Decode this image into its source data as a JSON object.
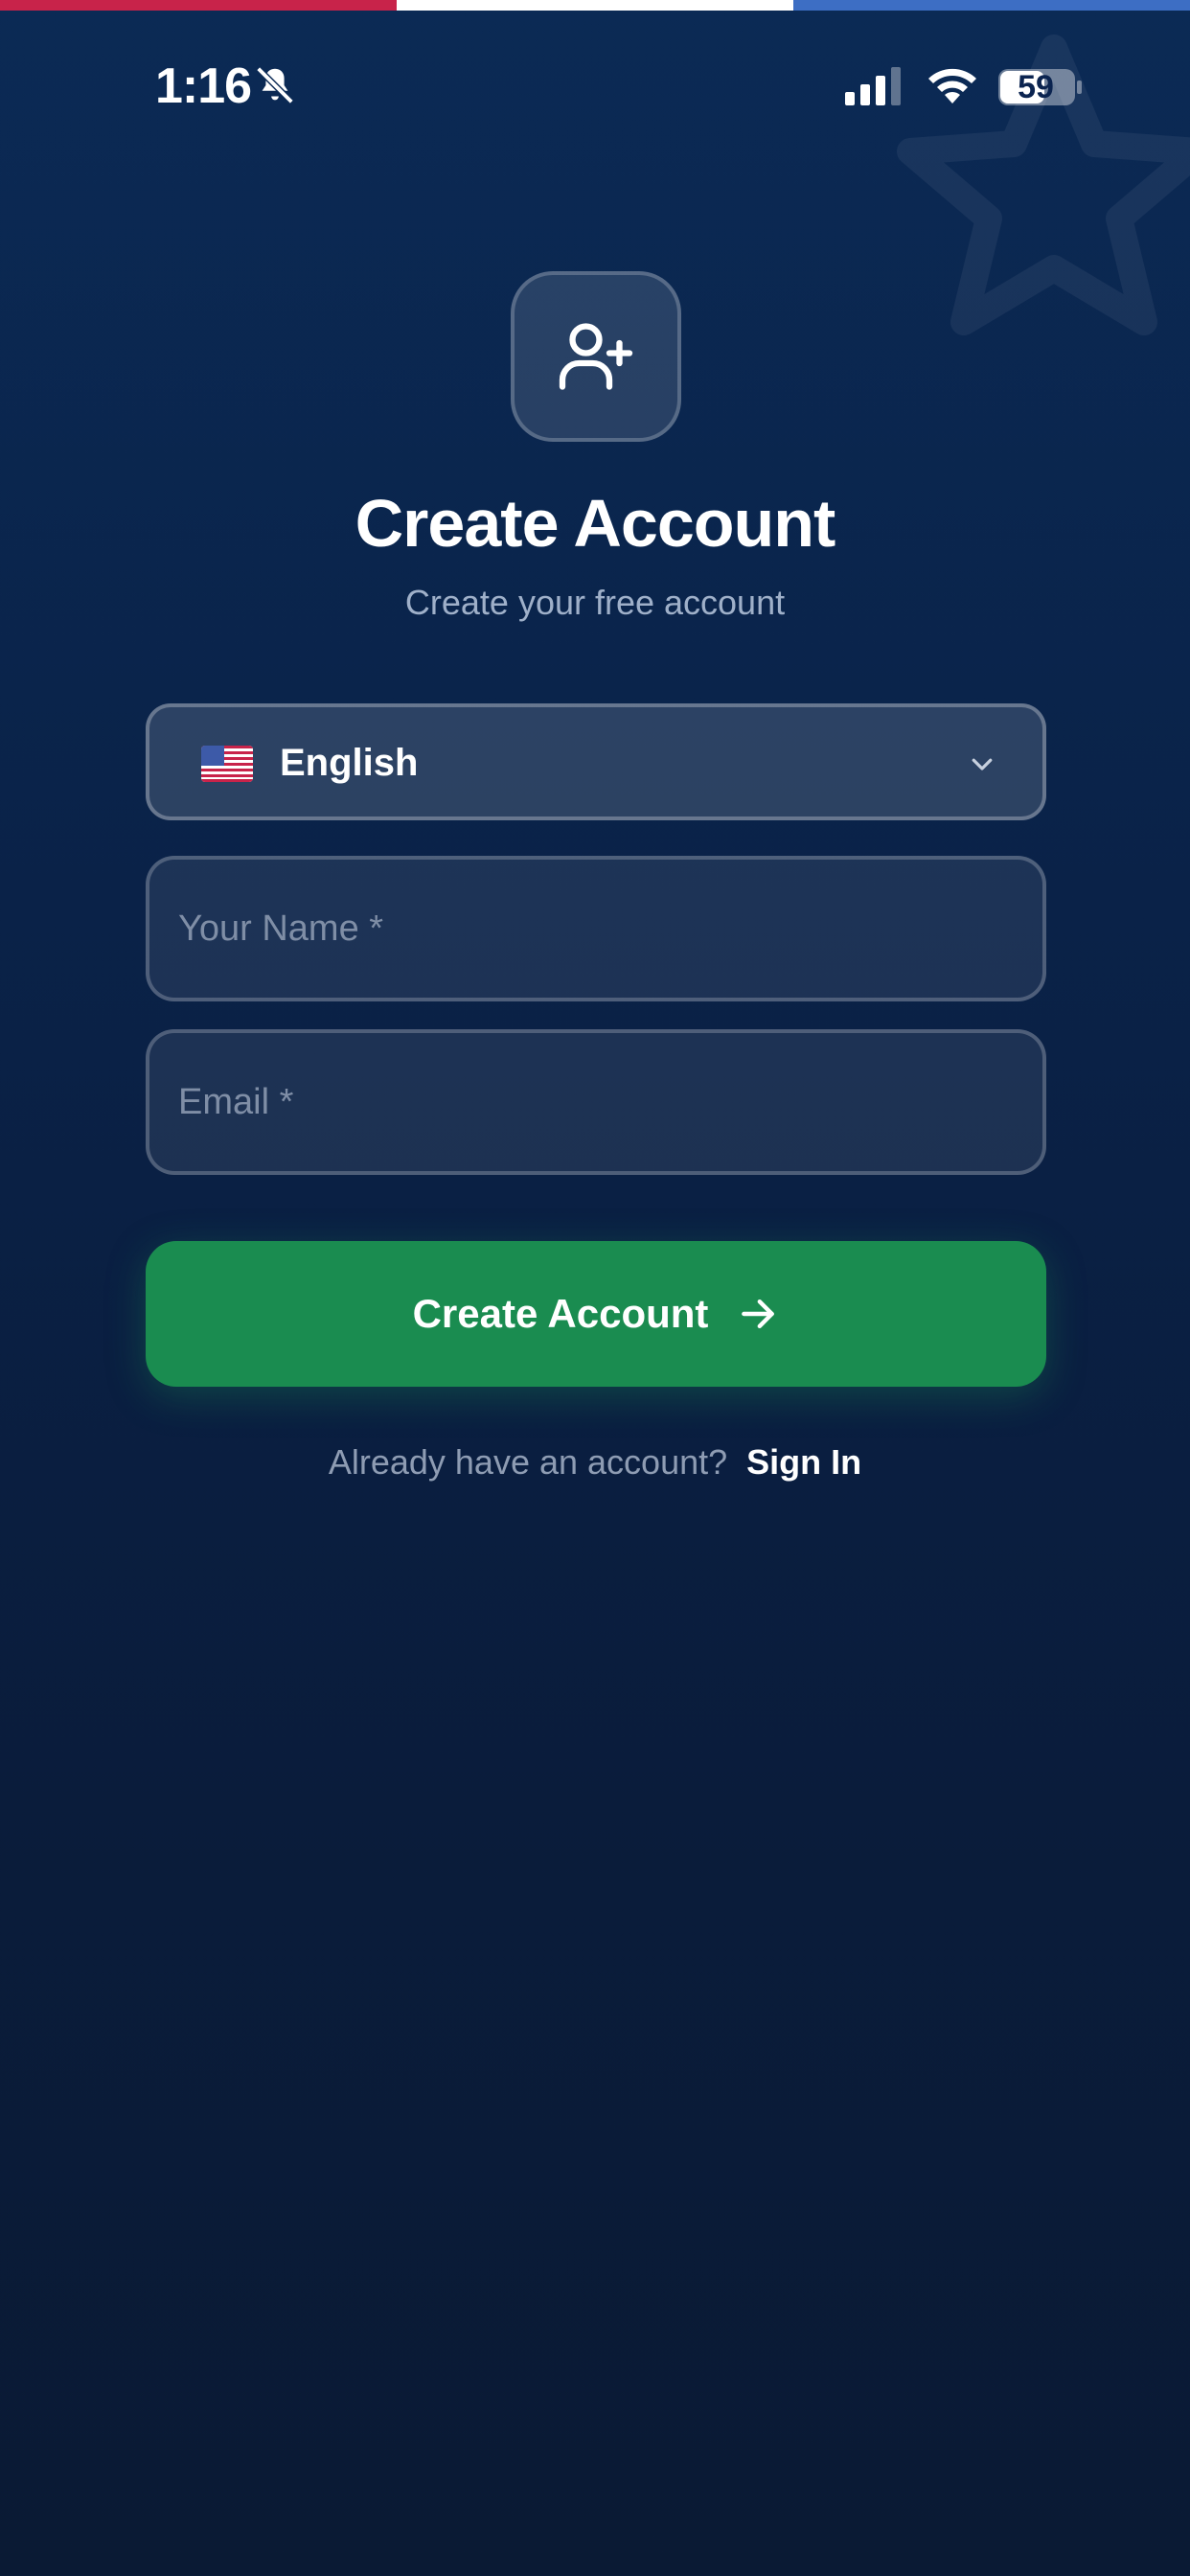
{
  "status_bar": {
    "time": "1:16",
    "battery": "59",
    "icons": [
      "bell-slash-icon",
      "signal-icon",
      "wifi-icon",
      "battery-icon"
    ]
  },
  "theme": {
    "flag_colors": [
      "#c8234a",
      "#ffffff",
      "#3d6ec4"
    ],
    "accent_green": "#1a8c50",
    "background": "#0b2450"
  },
  "header": {
    "icon": "user-plus-icon",
    "title": "Create Account",
    "subtitle": "Create your free account"
  },
  "form": {
    "language": {
      "flag_icon": "us-flag-icon",
      "selected": "English"
    },
    "name_field": {
      "value": "",
      "placeholder": "Your Name *"
    },
    "email_field": {
      "value": "",
      "placeholder": "Email *"
    },
    "submit_label": "Create Account"
  },
  "footer": {
    "prompt": "Already have an account?",
    "signin_label": "Sign In"
  }
}
